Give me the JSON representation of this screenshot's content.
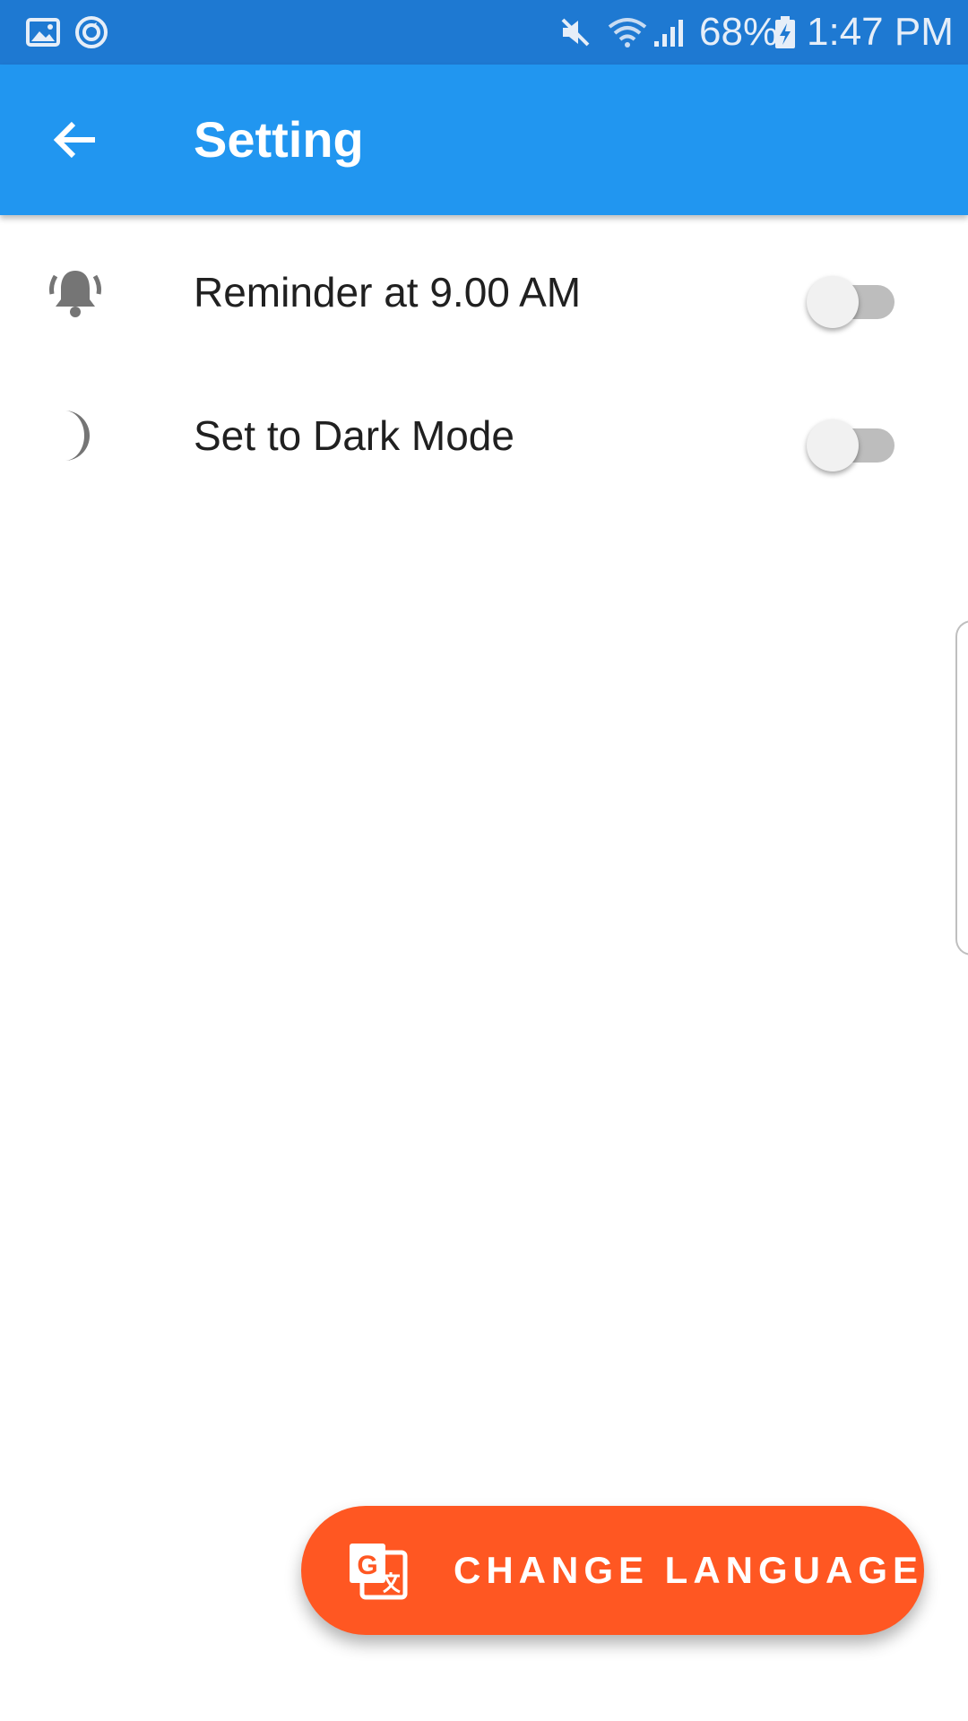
{
  "status_bar": {
    "battery": "68%",
    "time": "1:47 PM",
    "icons": [
      "image-icon",
      "sync-icon",
      "mute-icon",
      "wifi-icon",
      "signal-icon",
      "battery-charging-icon"
    ]
  },
  "app_bar": {
    "title": "Setting",
    "background": "#2196f0"
  },
  "settings": [
    {
      "icon": "bell-ringing-icon",
      "label": "Reminder at 9.00 AM",
      "enabled": false
    },
    {
      "icon": "moon-icon",
      "label": "Set to Dark Mode",
      "enabled": false
    }
  ],
  "fab": {
    "icon": "translate-icon",
    "label": "CHANGE LANGUAGE",
    "color": "#ff5722"
  }
}
